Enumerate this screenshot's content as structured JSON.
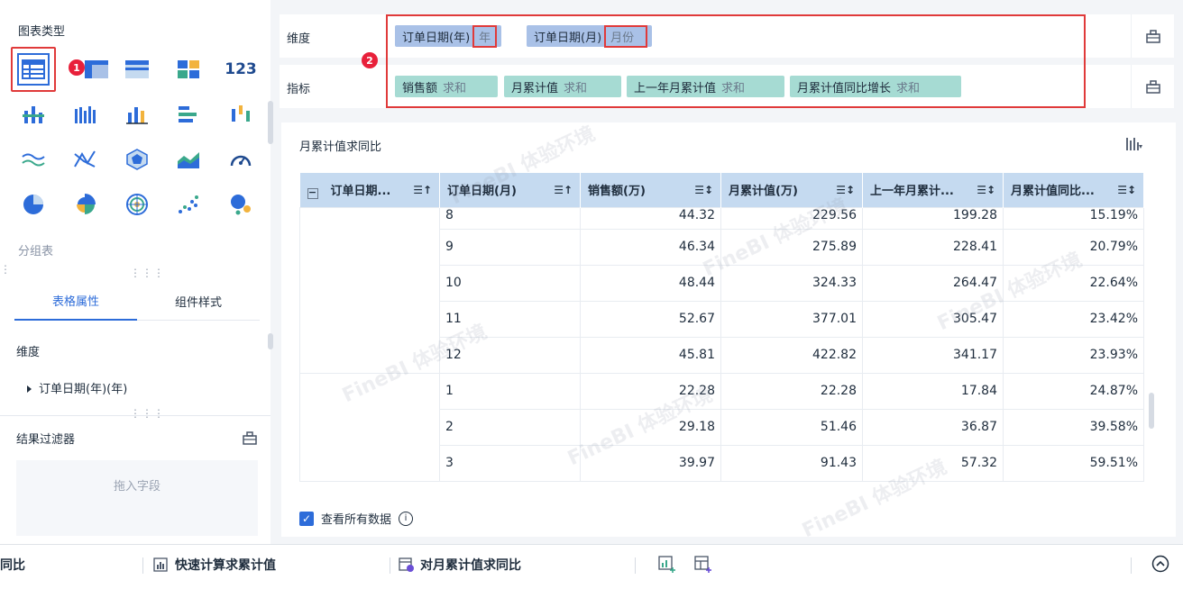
{
  "left_panel": {
    "chart_type_title": "图表类型",
    "chart_icons": [
      "table-icon",
      "crosstable-icon",
      "detail-table-icon",
      "kpi-grid-icon",
      "number-card-icon",
      "stacked-column-icon",
      "grouped-column-icon",
      "column-icon",
      "bar-icon",
      "range-column-icon",
      "area-wave-icon",
      "radar-line-icon",
      "polygon-icon",
      "area-chart-icon",
      "gauge-icon",
      "pie-icon",
      "rose-pie-icon",
      "radar-target-icon",
      "scatter-icon",
      "bubble-icon"
    ],
    "badge1": "1",
    "group_label": "分组表",
    "tabs": [
      "表格属性",
      "组件样式"
    ],
    "dimension_label": "维度",
    "tree_item": "订单日期(年)(年)",
    "result_filter": "结果过滤器",
    "drop_placeholder": "拖入字段"
  },
  "fields": {
    "dimension_label": "维度",
    "indicator_label": "指标",
    "badge2": "2",
    "dimensions": [
      {
        "name": "订单日期(年)",
        "sub": "年"
      },
      {
        "name": "订单日期(月)",
        "sub": "月份"
      }
    ],
    "indicators": [
      {
        "name": "销售额",
        "sub": "求和"
      },
      {
        "name": "月累计值",
        "sub": "求和"
      },
      {
        "name": "上一年月累计值",
        "sub": "求和"
      },
      {
        "name": "月累计值同比增长",
        "sub": "求和"
      }
    ]
  },
  "card": {
    "title": "月累计值求同比",
    "headers": [
      "订单日期...",
      "订单日期(月)",
      "销售额(万)",
      "月累计值(万)",
      "上一年月累计...",
      "月累计值同比..."
    ],
    "rows": [
      [
        "8",
        "44.32",
        "229.56",
        "199.28",
        "15.19%"
      ],
      [
        "9",
        "46.34",
        "275.89",
        "228.41",
        "20.79%"
      ],
      [
        "10",
        "48.44",
        "324.33",
        "264.47",
        "22.64%"
      ],
      [
        "11",
        "52.67",
        "377.01",
        "305.47",
        "23.42%"
      ],
      [
        "12",
        "45.81",
        "422.82",
        "341.17",
        "23.93%"
      ],
      [
        "1",
        "22.28",
        "22.28",
        "17.84",
        "24.87%"
      ],
      [
        "2",
        "29.18",
        "51.46",
        "36.87",
        "39.58%"
      ],
      [
        "3",
        "39.97",
        "91.43",
        "57.32",
        "59.51%"
      ]
    ],
    "view_all_label": "查看所有数据",
    "watermark": "FineBI 体验环境"
  },
  "bottom_bar": {
    "tab_partial": "同比",
    "tab_2": "快速计算求累计值",
    "tab_3": "对月累计值求同比"
  },
  "colors": {
    "accent": "#2d6cd9",
    "highlight_red": "#e03a3a",
    "dimension_pill": "#a9c1e7",
    "indicator_pill": "#a6dbd3",
    "table_header": "#c5daf0"
  }
}
